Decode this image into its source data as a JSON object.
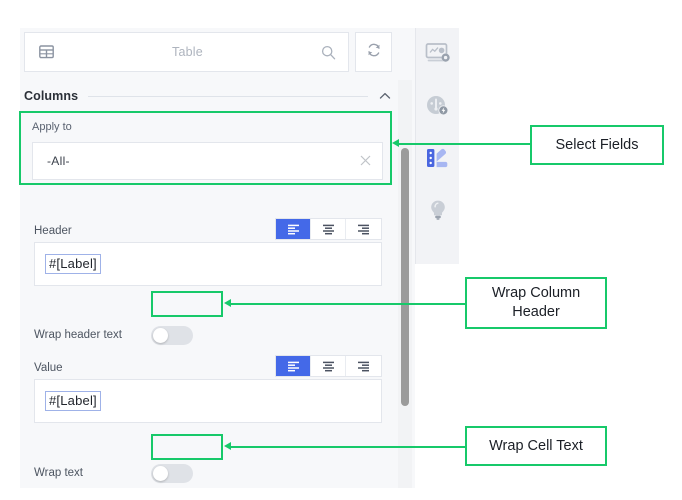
{
  "panel": {
    "search": {
      "icon": "table-icon",
      "placeholder": "Table",
      "value": "",
      "search_icon": "search-icon"
    },
    "refresh_button": {
      "icon": "refresh-icon",
      "tooltip": "Refresh"
    },
    "section": {
      "title": "Columns",
      "collapse_icon": "chevron-up-icon"
    },
    "apply_to": {
      "label": "Apply to",
      "value": "-All-",
      "clear_icon": "close-icon"
    },
    "header_field": {
      "label": "Header",
      "value": "#[Label]",
      "align_options": [
        "align-left-icon",
        "align-center-icon",
        "align-right-icon"
      ],
      "align_selected": 0
    },
    "wrap_header": {
      "label": "Wrap header text",
      "state": "off"
    },
    "value_field": {
      "label": "Value",
      "value": "#[Label]",
      "align_options": [
        "align-left-icon",
        "align-center-icon",
        "align-right-icon"
      ],
      "align_selected": 0
    },
    "wrap_text": {
      "label": "Wrap text",
      "state": "off"
    }
  },
  "toolbar": {
    "items": [
      {
        "name": "dashboard-settings-icon",
        "active": false
      },
      {
        "name": "gauge-performance-icon",
        "active": false
      },
      {
        "name": "palette-style-icon",
        "active": true
      },
      {
        "name": "lightbulb-insights-icon",
        "active": false
      }
    ]
  },
  "callouts": [
    {
      "text": "Select Fields"
    },
    {
      "text": "Wrap Column\nHeader",
      "line1": "Wrap Column",
      "line2": "Header"
    },
    {
      "text": "Wrap Cell Text"
    }
  ],
  "colors": {
    "accent_green": "#17c96a",
    "accent_blue": "#4469e8",
    "panel_bg": "#f7f8fa",
    "toolbar_bg": "#f2f3f6"
  }
}
